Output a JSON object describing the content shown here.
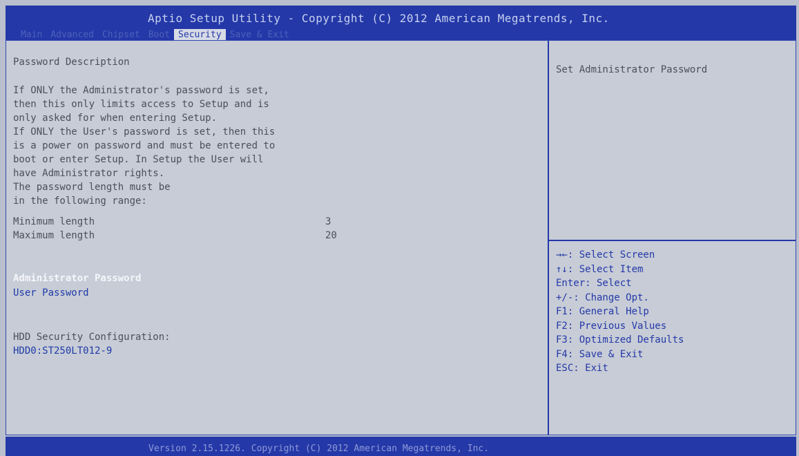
{
  "header": {
    "title": "Aptio Setup Utility - Copyright (C) 2012 American Megatrends, Inc.",
    "tabs": [
      "Main",
      "Advanced",
      "Chipset",
      "Boot",
      "Security",
      "Save & Exit"
    ],
    "active_tab": "Security"
  },
  "main": {
    "section_title": "Password Description",
    "description_lines": [
      "If ONLY the Administrator's password is set,",
      "then this only limits access to Setup and is",
      "only asked for when entering Setup.",
      "If ONLY the User's password is set, then this",
      "is a power on password and must be entered to",
      "boot or enter Setup. In Setup the User will",
      "have Administrator rights.",
      "The password length must be",
      "in the following range:"
    ],
    "min_length": {
      "label": "Minimum length",
      "value": "3"
    },
    "max_length": {
      "label": "Maximum length",
      "value": "20"
    },
    "admin_password": "Administrator Password",
    "user_password": "User Password",
    "hdd_heading": "HDD Security Configuration:",
    "hdd_item": "HDD0:ST250LT012-9"
  },
  "help": {
    "text": "Set Administrator Password"
  },
  "key_help": [
    "→←: Select Screen",
    "↑↓: Select Item",
    "Enter: Select",
    "+/-: Change Opt.",
    "F1: General Help",
    "F2: Previous Values",
    "F3: Optimized Defaults",
    "F4: Save & Exit",
    "ESC: Exit"
  ],
  "footer": "Version 2.15.1226. Copyright (C) 2012 American Megatrends, Inc.",
  "colors": {
    "bar": "#2438a8",
    "panel": "#c7ccd6",
    "selected": "#f5f6fa",
    "link": "#1f3aa8"
  }
}
